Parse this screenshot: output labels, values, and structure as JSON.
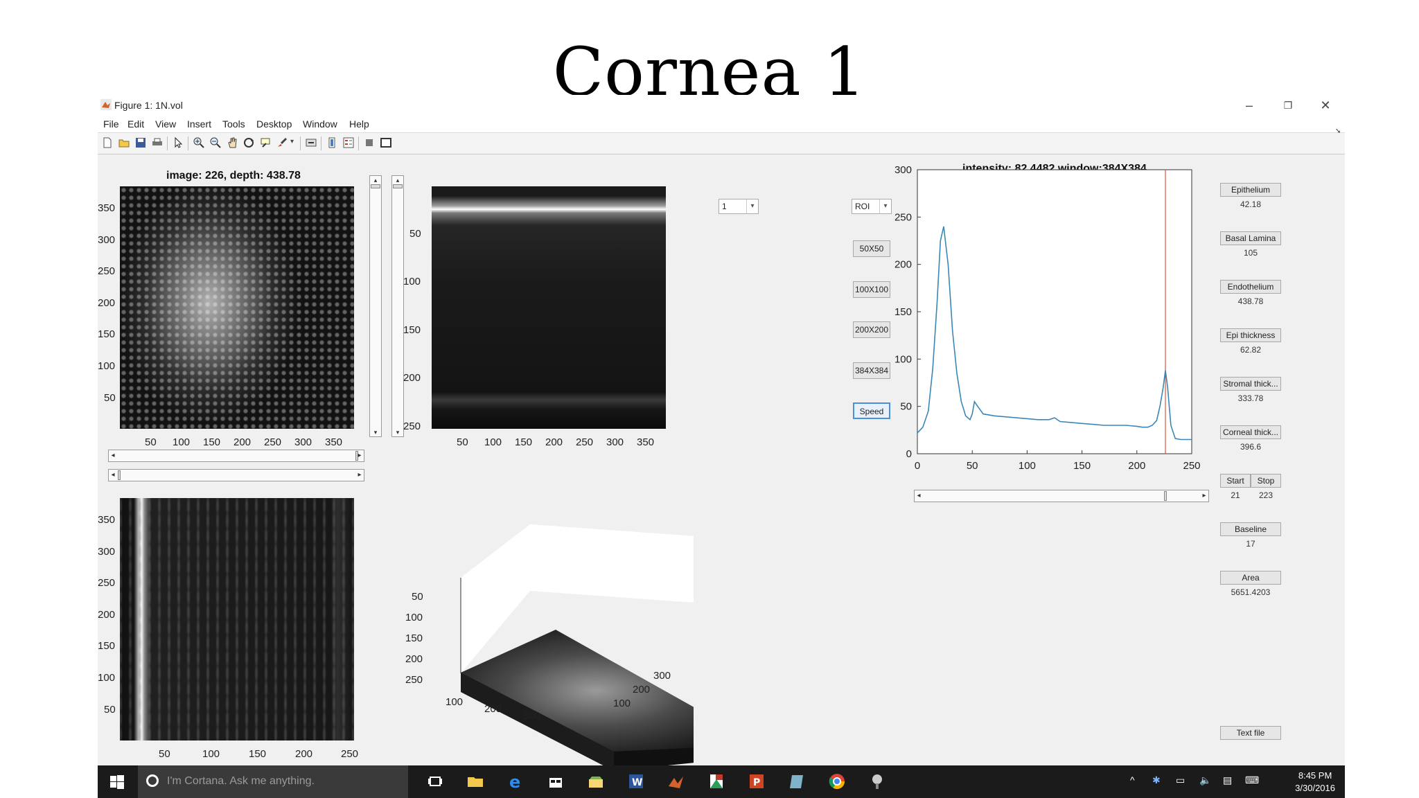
{
  "slide_title": "Cornea 1",
  "window": {
    "title": "Figure 1: 1N.vol",
    "controls": {
      "minimize": "–",
      "restore": "❐",
      "close": "✕"
    }
  },
  "menu": [
    "File",
    "Edit",
    "View",
    "Insert",
    "Tools",
    "Desktop",
    "Window",
    "Help"
  ],
  "toolbar_icons": [
    "new-file-icon",
    "open-folder-icon",
    "save-icon",
    "print-icon",
    "pointer-icon",
    "zoom-in-icon",
    "zoom-out-icon",
    "pan-icon",
    "rotate-icon",
    "data-cursor-icon",
    "brush-icon",
    "link-icon",
    "colorbar-icon",
    "legend-icon",
    "hide-tools-icon",
    "show-tools-icon"
  ],
  "panel_en_face": {
    "title": "image: 226, depth: 438.78",
    "y_ticks": [
      "350",
      "300",
      "250",
      "200",
      "150",
      "100",
      "50"
    ],
    "x_ticks": [
      "50",
      "100",
      "150",
      "200",
      "250",
      "300",
      "350"
    ]
  },
  "panel_xsection": {
    "y_ticks": [
      "50",
      "100",
      "150",
      "200",
      "250"
    ],
    "x_ticks": [
      "50",
      "100",
      "150",
      "200",
      "250",
      "300",
      "350"
    ]
  },
  "panel_ysection": {
    "y_ticks": [
      "350",
      "300",
      "250",
      "200",
      "150",
      "100",
      "50"
    ],
    "x_ticks": [
      "50",
      "100",
      "150",
      "200",
      "250"
    ]
  },
  "panel_3d": {
    "z_ticks": [
      "50",
      "100",
      "150",
      "200",
      "250"
    ],
    "x_ticks": [
      "100",
      "200",
      "300"
    ],
    "y_ticks": [
      "100",
      "200",
      "300"
    ]
  },
  "controls": {
    "frame_select": "1",
    "roi_select": "ROI",
    "buttons": [
      "50X50",
      "100X100",
      "200X200",
      "384X384",
      "Speed"
    ]
  },
  "chart_data": {
    "type": "line",
    "title": "intensity: 82.4482,window:384X384",
    "xlabel": "",
    "ylabel": "",
    "xlim": [
      0,
      250
    ],
    "ylim": [
      0,
      300
    ],
    "x_ticks": [
      "0",
      "50",
      "100",
      "150",
      "200",
      "250"
    ],
    "y_ticks": [
      "0",
      "50",
      "100",
      "150",
      "200",
      "250",
      "300"
    ],
    "series": [
      {
        "x": [
          0,
          5,
          10,
          14,
          18,
          21,
          24,
          28,
          32,
          36,
          40,
          44,
          48,
          50,
          52,
          55,
          60,
          70,
          80,
          90,
          100,
          110,
          120,
          125,
          130,
          140,
          150,
          160,
          170,
          180,
          190,
          200,
          205,
          210,
          214,
          218,
          221,
          224,
          226,
          228,
          231,
          235,
          240,
          245,
          250
        ],
        "y": [
          22,
          28,
          45,
          90,
          160,
          225,
          240,
          200,
          130,
          85,
          55,
          40,
          36,
          42,
          55,
          50,
          42,
          40,
          39,
          38,
          37,
          36,
          36,
          38,
          34,
          33,
          32,
          31,
          30,
          30,
          30,
          29,
          28,
          28,
          30,
          35,
          50,
          70,
          88,
          70,
          30,
          16,
          15,
          15,
          15
        ],
        "color": "#3a86b8"
      }
    ],
    "marker_x": 226,
    "marker_color": "#d9553a"
  },
  "right_panel": [
    {
      "label": "Epithelium",
      "value": "42.18"
    },
    {
      "label": "Basal Lamina",
      "value": "105"
    },
    {
      "label": "Endothelium",
      "value": "438.78"
    },
    {
      "label": "Epi thickness",
      "value": "62.82"
    },
    {
      "label": "Stromal thick...",
      "value": "333.78"
    },
    {
      "label": "Corneal thick...",
      "value": "396.6"
    }
  ],
  "start_stop": {
    "start_label": "Start",
    "stop_label": "Stop",
    "start_value": "21",
    "stop_value": "223"
  },
  "baseline": {
    "label": "Baseline",
    "value": "17"
  },
  "area": {
    "label": "Area",
    "value": "5651.4203"
  },
  "text_file_button": "Text file",
  "taskbar": {
    "search_placeholder": "I'm Cortana. Ask me anything.",
    "time": "8:45 PM",
    "date": "3/30/2016"
  }
}
